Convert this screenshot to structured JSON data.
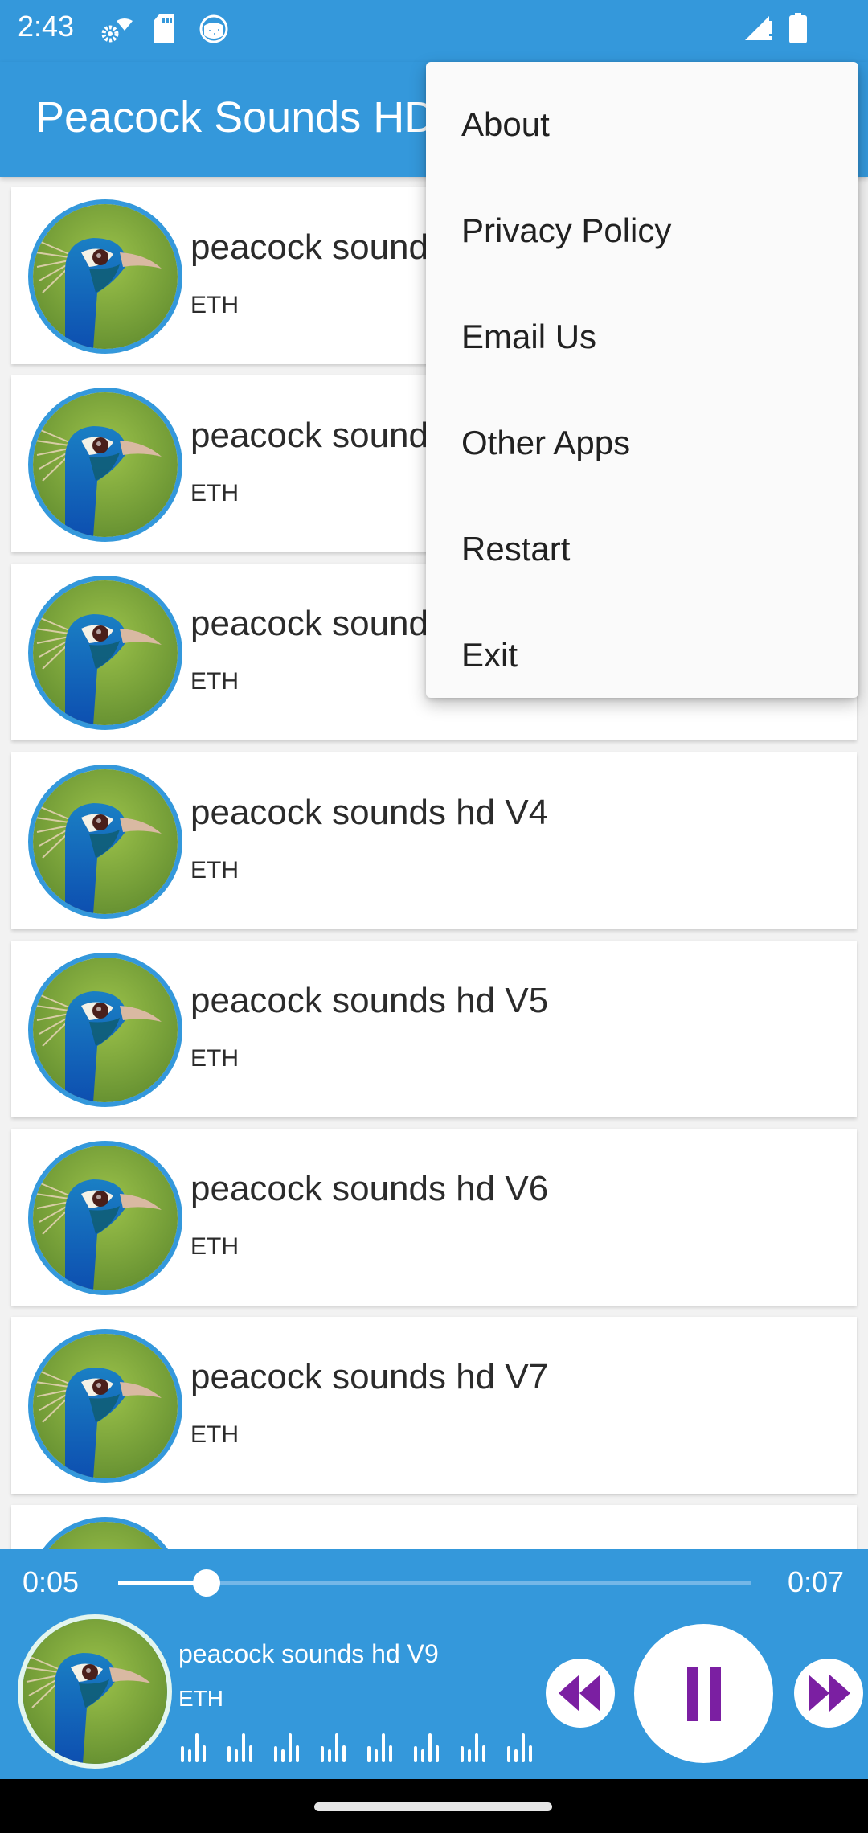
{
  "status_bar": {
    "time": "2:43",
    "left_icons": [
      "settings-wifi-icon",
      "sd-card-icon",
      "android-app-icon"
    ],
    "right_icons": [
      "signal-alert-icon",
      "battery-icon"
    ]
  },
  "app_bar": {
    "title": "Peacock Sounds HD"
  },
  "overflow_menu": {
    "items": [
      {
        "label": "About"
      },
      {
        "label": "Privacy Policy"
      },
      {
        "label": "Email Us"
      },
      {
        "label": "Other Apps"
      },
      {
        "label": "Restart"
      },
      {
        "label": "Exit"
      }
    ]
  },
  "tracks": [
    {
      "title": "peacock sound",
      "artist": "ETH"
    },
    {
      "title": "peacock sound",
      "artist": "ETH"
    },
    {
      "title": "peacock sound",
      "artist": "ETH"
    },
    {
      "title": "peacock sounds hd V4",
      "artist": "ETH"
    },
    {
      "title": "peacock sounds hd V5",
      "artist": "ETH"
    },
    {
      "title": "peacock sounds hd V6",
      "artist": "ETH"
    },
    {
      "title": "peacock sounds hd V7",
      "artist": "ETH"
    },
    {
      "title": "",
      "artist": ""
    }
  ],
  "player": {
    "elapsed": "0:05",
    "duration": "0:07",
    "progress_fraction": 0.14,
    "now_playing_title": "peacock sounds hd V9",
    "now_playing_artist": "ETH",
    "state": "playing",
    "controls": [
      "rewind-icon",
      "pause-icon",
      "fast-forward-icon"
    ]
  },
  "colors": {
    "primary": "#3498db",
    "control_icon": "#7b1fa2",
    "menu_bg": "#fafafa",
    "list_bg": "#f2f2f2"
  }
}
